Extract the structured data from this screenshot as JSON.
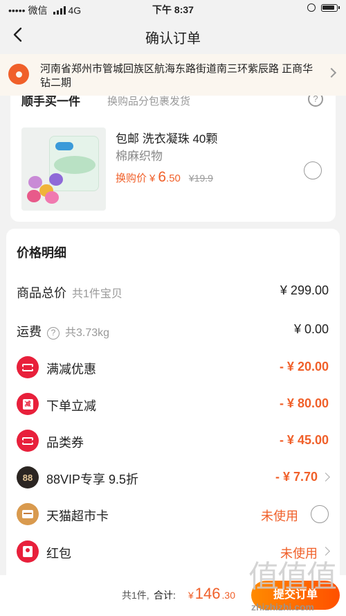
{
  "status_bar": {
    "carrier": "微信",
    "network": "4G",
    "time": "下午 8:37"
  },
  "nav": {
    "title": "确认订单"
  },
  "address": {
    "text": "河南省郑州市管城回族区航海东路街道南三环紫辰路 正商华钻二期"
  },
  "addon": {
    "title": "顺手买一件",
    "subtitle": "换购品分包裹发货",
    "product": {
      "title": "包邮 洗衣凝珠 40颗",
      "subtitle": "棉麻织物",
      "price_label": "换购价",
      "currency": "¥",
      "price_int": "6",
      "price_dec": ".50",
      "orig_price": "¥19.9"
    }
  },
  "price_details": {
    "title": "价格明细",
    "total": {
      "label": "商品总价",
      "sub": "共1件宝贝",
      "value": "¥ 299.00"
    },
    "shipping": {
      "label": "运费",
      "sub": "共3.73kg",
      "value": "¥ 0.00"
    },
    "items": [
      {
        "label": "满减优惠",
        "value": "- ¥ 20.00",
        "icon": "ticket-icon",
        "icon_color": "#e8203b"
      },
      {
        "label": "下单立减",
        "value": "- ¥ 80.00",
        "icon": "minus-icon",
        "icon_color": "#e8203b",
        "icon_text": "减"
      },
      {
        "label": "品类券",
        "value": "- ¥ 45.00",
        "icon": "ticket-icon",
        "icon_color": "#e8203b"
      },
      {
        "label": "88VIP专享 9.5折",
        "value": "- ¥ 7.70",
        "icon": "vip88-icon",
        "icon_color": "#2b2522",
        "icon_text": "88"
      },
      {
        "label": "天猫超市卡",
        "value": "未使用",
        "icon": "card-icon",
        "icon_color": "#d99a4e"
      },
      {
        "label": "红包",
        "value": "未使用",
        "icon": "red-envelope-icon",
        "icon_color": "#e8203b"
      }
    ]
  },
  "footer": {
    "count": "共1件,",
    "total_label": "合计:",
    "currency": "¥",
    "total_int": "146",
    "total_dec": ".30",
    "submit_label": "提交订单"
  },
  "watermark": {
    "glyphs": "值值值",
    "url": "zhizhizhi.com"
  }
}
